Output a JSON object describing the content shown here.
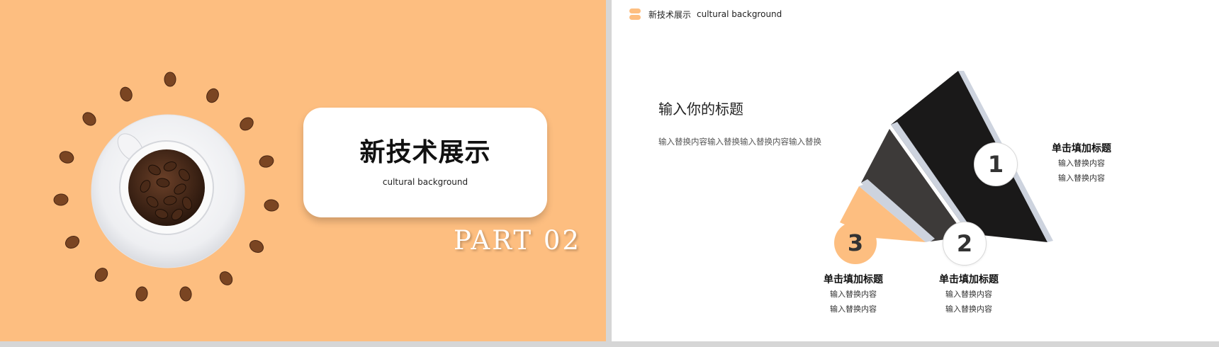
{
  "left_slide": {
    "title": "新技术展示",
    "subtitle": "cultural background",
    "part_label": "PART  02"
  },
  "right_slide": {
    "header": {
      "title": "新技术展示",
      "subtitle": "cultural background"
    },
    "section": {
      "title": "输入你的标题",
      "description": "输入替换内容输入替换输入替换内容输入替换"
    },
    "steps": [
      {
        "number": "1",
        "title": "单击填加标题",
        "lines": [
          "输入替换内容",
          "输入替换内容"
        ]
      },
      {
        "number": "2",
        "title": "单击填加标题",
        "lines": [
          "输入替换内容",
          "输入替换内容"
        ]
      },
      {
        "number": "3",
        "title": "单击填加标题",
        "lines": [
          "输入替换内容",
          "输入替换内容"
        ]
      }
    ]
  },
  "colors": {
    "accent": "#fdbe80",
    "dark": "#1a1919",
    "mid": "#3d3a39",
    "bevel": "#cdd3de"
  },
  "icons": [
    "coffee-cup-icon",
    "coffee-bean-icon",
    "header-badge-icon"
  ]
}
